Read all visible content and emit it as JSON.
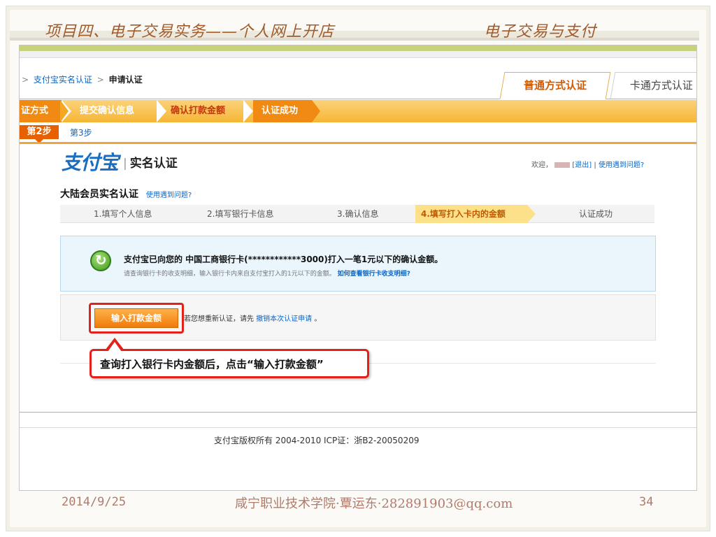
{
  "slide": {
    "header_title": "项目四、电子交易实务——个人网上开店",
    "header_right": "电子交易与支付",
    "footer_date": "2014/9/25",
    "footer_center": "咸宁职业技术学院·覃运东·282891903@qq.com",
    "page_number": "34"
  },
  "breadcrumb": {
    "link": "支付宝实名认证",
    "sep": ">",
    "current": "申请认证"
  },
  "tabs": {
    "active": "普通方式认证",
    "inactive": "卡通方式认证"
  },
  "stepbar": {
    "items": [
      "证方式",
      "提交确认信息",
      "确认打款金额",
      "认证成功"
    ]
  },
  "mini_steps": {
    "current": "第2步",
    "next": "第3步"
  },
  "logo": {
    "brand": "支付宝",
    "sub": "实名认证"
  },
  "welcome": {
    "prefix": "欢迎，",
    "logout": "[退出]",
    "bar": " | ",
    "help": "使用遇到问题?"
  },
  "section": {
    "title": "大陆会员实名认证",
    "help": "使用遇到问题?"
  },
  "progress": {
    "steps": [
      "1.填写个人信息",
      "2.填写银行卡信息",
      "3.确认信息",
      "4.填写打入卡内的金额",
      "认证成功"
    ]
  },
  "info": {
    "main": "支付宝已向您的 中国工商银行卡(************3000)打入一笔1元以下的确认金额。",
    "sub": "请查询银行卡的收支明细，输入银行卡内来自支付宝打入的1元以下的金额。",
    "sub_link": "如何查看银行卡收支明细?"
  },
  "action": {
    "button": "输入打款金额",
    "text_prefix": "若您想重新认证，请先",
    "text_link": "撤销本次认证申请",
    "text_suffix": "。"
  },
  "callout": {
    "text": "查询打入银行卡内金额后，点击“输入打款金额”"
  },
  "footer": {
    "copyright": "支付宝版权所有 2004-2010 ICP证：浙B2-20050209"
  },
  "colors": {
    "accent_orange": "#f08a12",
    "link_blue": "#0b66c4",
    "highlight_red": "#e2221a",
    "slide_text": "#a15a2a"
  }
}
